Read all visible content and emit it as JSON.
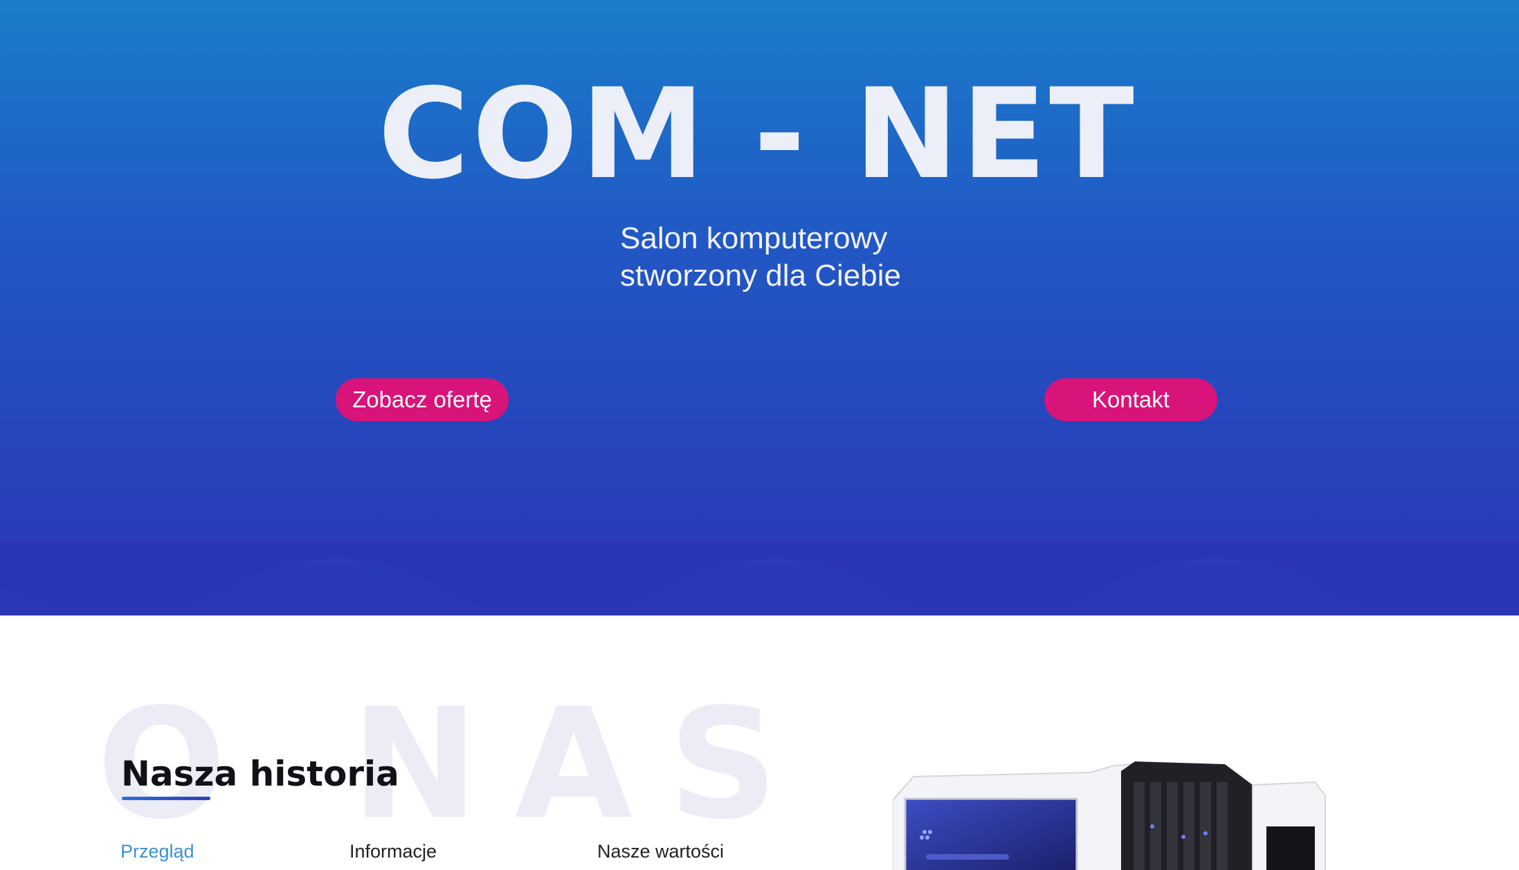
{
  "hero": {
    "title": "COM - NET",
    "tagline_line1": "Salon komputerowy",
    "tagline_line2": "stworzony dla Ciebie",
    "offer_button": "Zobacz ofertę",
    "contact_button": "Kontakt"
  },
  "about": {
    "background_text": "O NAS",
    "section_title": "Nasza historia",
    "tabs": [
      {
        "label": "Przegląd",
        "active": true
      },
      {
        "label": "Informacje",
        "active": false
      },
      {
        "label": "Nasze wartości",
        "active": false
      }
    ]
  },
  "colors": {
    "hero_top": "#1a7dca",
    "hero_bottom": "#2b36b4",
    "button": "#d8137a",
    "active_tab": "#3b8fd6"
  }
}
